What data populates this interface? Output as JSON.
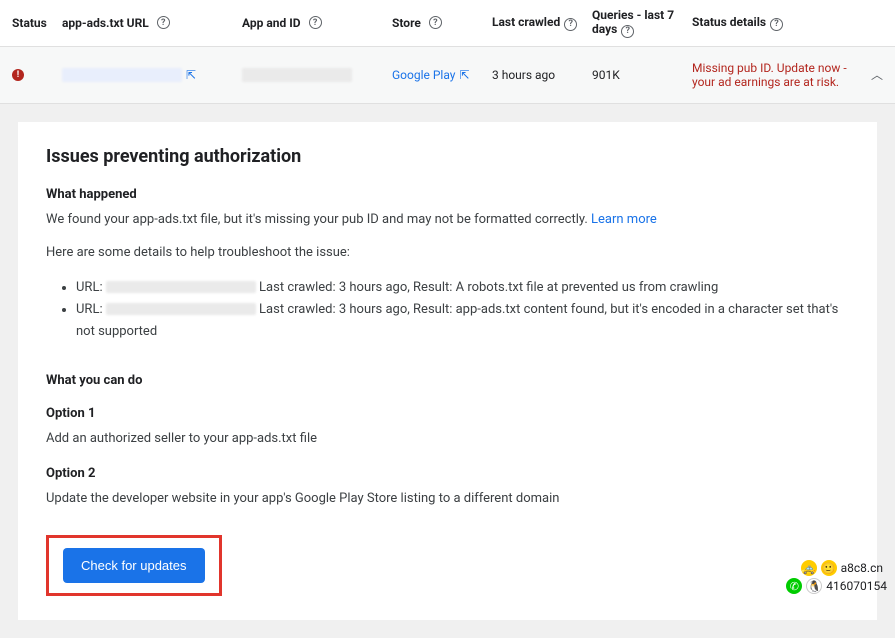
{
  "headers": {
    "status": "Status",
    "url": "app-ads.txt URL",
    "app": "App and ID",
    "store": "Store",
    "crawled": "Last crawled",
    "queries": "Queries - last 7 days",
    "details": "Status details"
  },
  "row": {
    "store": "Google Play",
    "crawled": "3 hours ago",
    "queries": "901K",
    "status_detail": "Missing pub ID. Update now - your ad earnings are at risk."
  },
  "card": {
    "title": "Issues preventing authorization",
    "what_happened_h": "What happened",
    "what_happened_p": "We found your app-ads.txt file, but it's missing your pub ID and may not be formatted correctly.",
    "learn_more": "Learn more",
    "troubleshoot_intro": "Here are some details to help troubleshoot the issue:",
    "item1_prefix": "URL:",
    "item1_rest": " Last crawled: 3 hours ago, Result: A robots.txt file at prevented us from crawling",
    "item2_prefix": "URL:",
    "item2_rest": " Last crawled: 3 hours ago, Result: app-ads.txt content found, but it's encoded in a character set that's not supported",
    "what_can_do_h": "What you can do",
    "option1_h": "Option 1",
    "option1_p": "Add an authorized seller to your app-ads.txt file",
    "option2_h": "Option 2",
    "option2_p": "Update the developer website in your app's Google Play Store listing to a different domain",
    "button": "Check for updates"
  },
  "footer": {
    "domain": "a8c8.cn",
    "qq": "416070154"
  }
}
